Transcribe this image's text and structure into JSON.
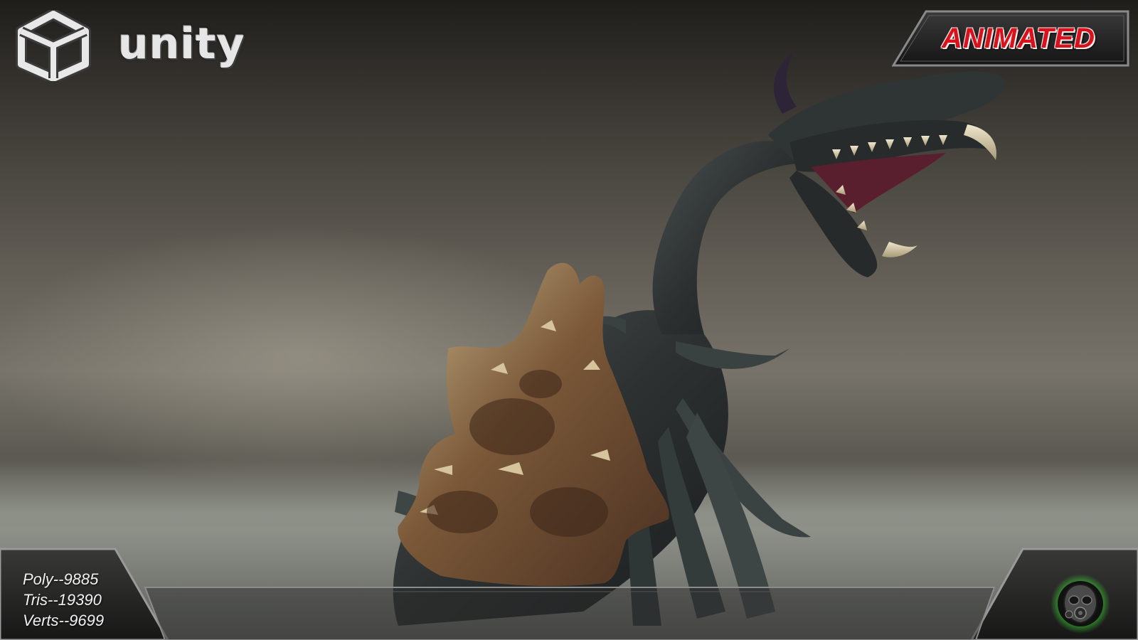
{
  "logo": {
    "wordmark": "unity",
    "icon": "unity-cube-icon"
  },
  "badge": {
    "label": "ANIMATED",
    "color": "#d8121c"
  },
  "stats": {
    "poly": "Poly--9885",
    "tris": "Tris--19390",
    "verts": "Verts--9699"
  },
  "emblem": {
    "icon": "gas-mask-icon",
    "glow_color": "#3cdc32"
  },
  "scene": {
    "subject": "dragon-creature-model"
  }
}
